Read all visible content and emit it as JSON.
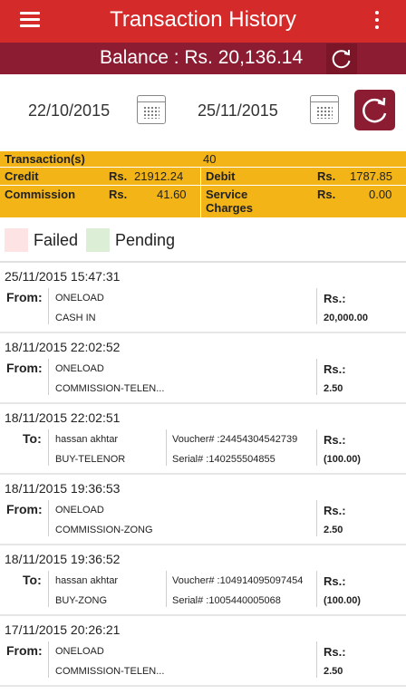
{
  "appbar": {
    "title": "Transaction History",
    "menu_icon": "hamburger-icon",
    "more_icon": "overflow-menu-icon"
  },
  "balance": {
    "text": "Balance : Rs. 20,136.14",
    "refresh_icon": "refresh-icon"
  },
  "dates": {
    "from": "22/10/2015",
    "to": "25/11/2015",
    "refresh_icon": "refresh-icon"
  },
  "summary": {
    "transactions_label": "Transaction(s)",
    "transactions_value": "40",
    "credit_label": "Credit",
    "credit_currency": "Rs.",
    "credit_value": "21912.24",
    "debit_label": "Debit",
    "debit_currency": "Rs.",
    "debit_value": "1787.85",
    "commission_label": "Commission",
    "commission_currency": "Rs.",
    "commission_value": "41.60",
    "service_label_1": "Service",
    "service_label_2": "Charges",
    "service_currency": "Rs.",
    "service_value": "0.00"
  },
  "legend": {
    "failed": "Failed",
    "pending": "Pending",
    "failed_color": "#fde3e3",
    "pending_color": "#dcefd6"
  },
  "transactions": [
    {
      "timestamp": "25/11/2015 15:47:31",
      "kind": "From:",
      "line1": "ONELOAD",
      "line2": "CASH IN",
      "voucher": "",
      "serial": "",
      "currency": "Rs.:",
      "amount": "20,000.00"
    },
    {
      "timestamp": "18/11/2015 22:02:52",
      "kind": "From:",
      "line1": "ONELOAD",
      "line2": "COMMISSION-TELEN...",
      "voucher": "",
      "serial": "",
      "currency": "Rs.:",
      "amount": "2.50"
    },
    {
      "timestamp": "18/11/2015 22:02:51",
      "kind": "To:",
      "line1": "hassan akhtar",
      "line2": "BUY-TELENOR",
      "voucher": "Voucher# :24454304542739",
      "serial": "Serial# :140255504855",
      "currency": "Rs.:",
      "amount": "(100.00)"
    },
    {
      "timestamp": "18/11/2015 19:36:53",
      "kind": "From:",
      "line1": "ONELOAD",
      "line2": "COMMISSION-ZONG",
      "voucher": "",
      "serial": "",
      "currency": "Rs.:",
      "amount": "2.50"
    },
    {
      "timestamp": "18/11/2015 19:36:52",
      "kind": "To:",
      "line1": "hassan akhtar",
      "line2": "BUY-ZONG",
      "voucher": "Voucher# :104914095097454",
      "serial": "Serial# :1005440005068",
      "currency": "Rs.:",
      "amount": "(100.00)"
    },
    {
      "timestamp": "17/11/2015 20:26:21",
      "kind": "From:",
      "line1": "ONELOAD",
      "line2": "COMMISSION-TELEN...",
      "voucher": "",
      "serial": "",
      "currency": "Rs.:",
      "amount": "2.50"
    }
  ]
}
